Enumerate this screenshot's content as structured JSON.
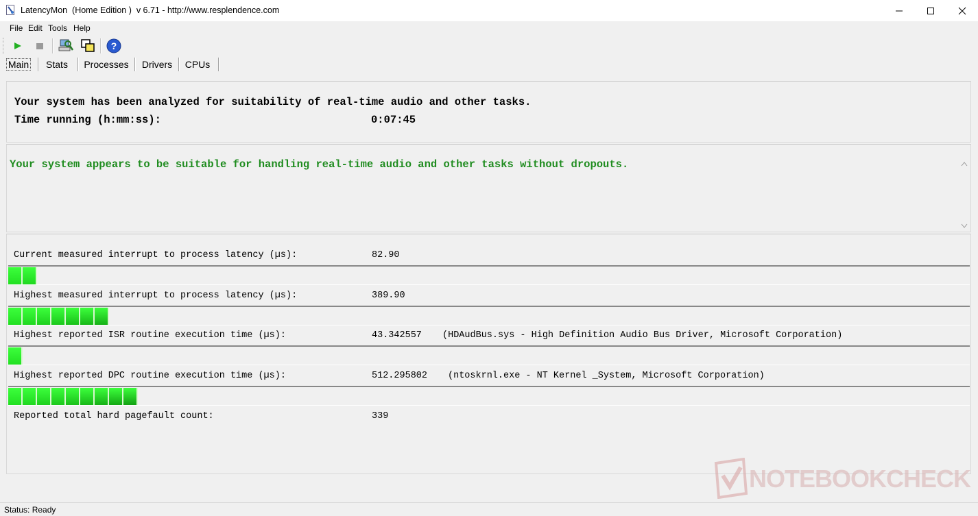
{
  "window": {
    "title": "LatencyMon  (Home Edition )  v 6.71 - http://www.resplendence.com"
  },
  "menu": [
    "File",
    "Edit",
    "Tools",
    "Help"
  ],
  "toolbar": {
    "icons": [
      "play-icon",
      "stop-icon",
      "computer-search-icon",
      "windows-icon",
      "help-icon"
    ]
  },
  "tabs": [
    "Main",
    "Stats",
    "Processes",
    "Drivers",
    "CPUs"
  ],
  "summary": {
    "line1": "Your system has been analyzed for suitability of real-time audio and other tasks.",
    "time_label": "Time running (h:mm:ss):",
    "time_value": "0:07:45"
  },
  "verdict": {
    "text": "Your system appears to be suitable for handling real-time audio and other tasks without dropouts.",
    "color": "#1f8c1f"
  },
  "metrics": [
    {
      "label": "Current measured interrupt to process latency (µs):",
      "value": "82.90",
      "detail": "",
      "bar_segments": 2
    },
    {
      "label": "Highest measured interrupt to process latency (µs):",
      "value": "389.90",
      "detail": "",
      "bar_segments": 7
    },
    {
      "label": "Highest reported ISR routine execution time (µs):",
      "value": "43.342557",
      "detail": "(HDAudBus.sys - High Definition Audio Bus Driver, Microsoft Corporation)",
      "bar_segments": 1
    },
    {
      "label": "Highest reported DPC routine execution time (µs):",
      "value": "512.295802",
      "detail": "(ntoskrnl.exe - NT Kernel _System, Microsoft Corporation)",
      "bar_segments": 9
    },
    {
      "label": "Reported total hard pagefault count:",
      "value": "339",
      "detail": ""
    }
  ],
  "status": {
    "text": "Status: Ready"
  },
  "watermark": {
    "text": "NOTEBOOKCHECK"
  }
}
